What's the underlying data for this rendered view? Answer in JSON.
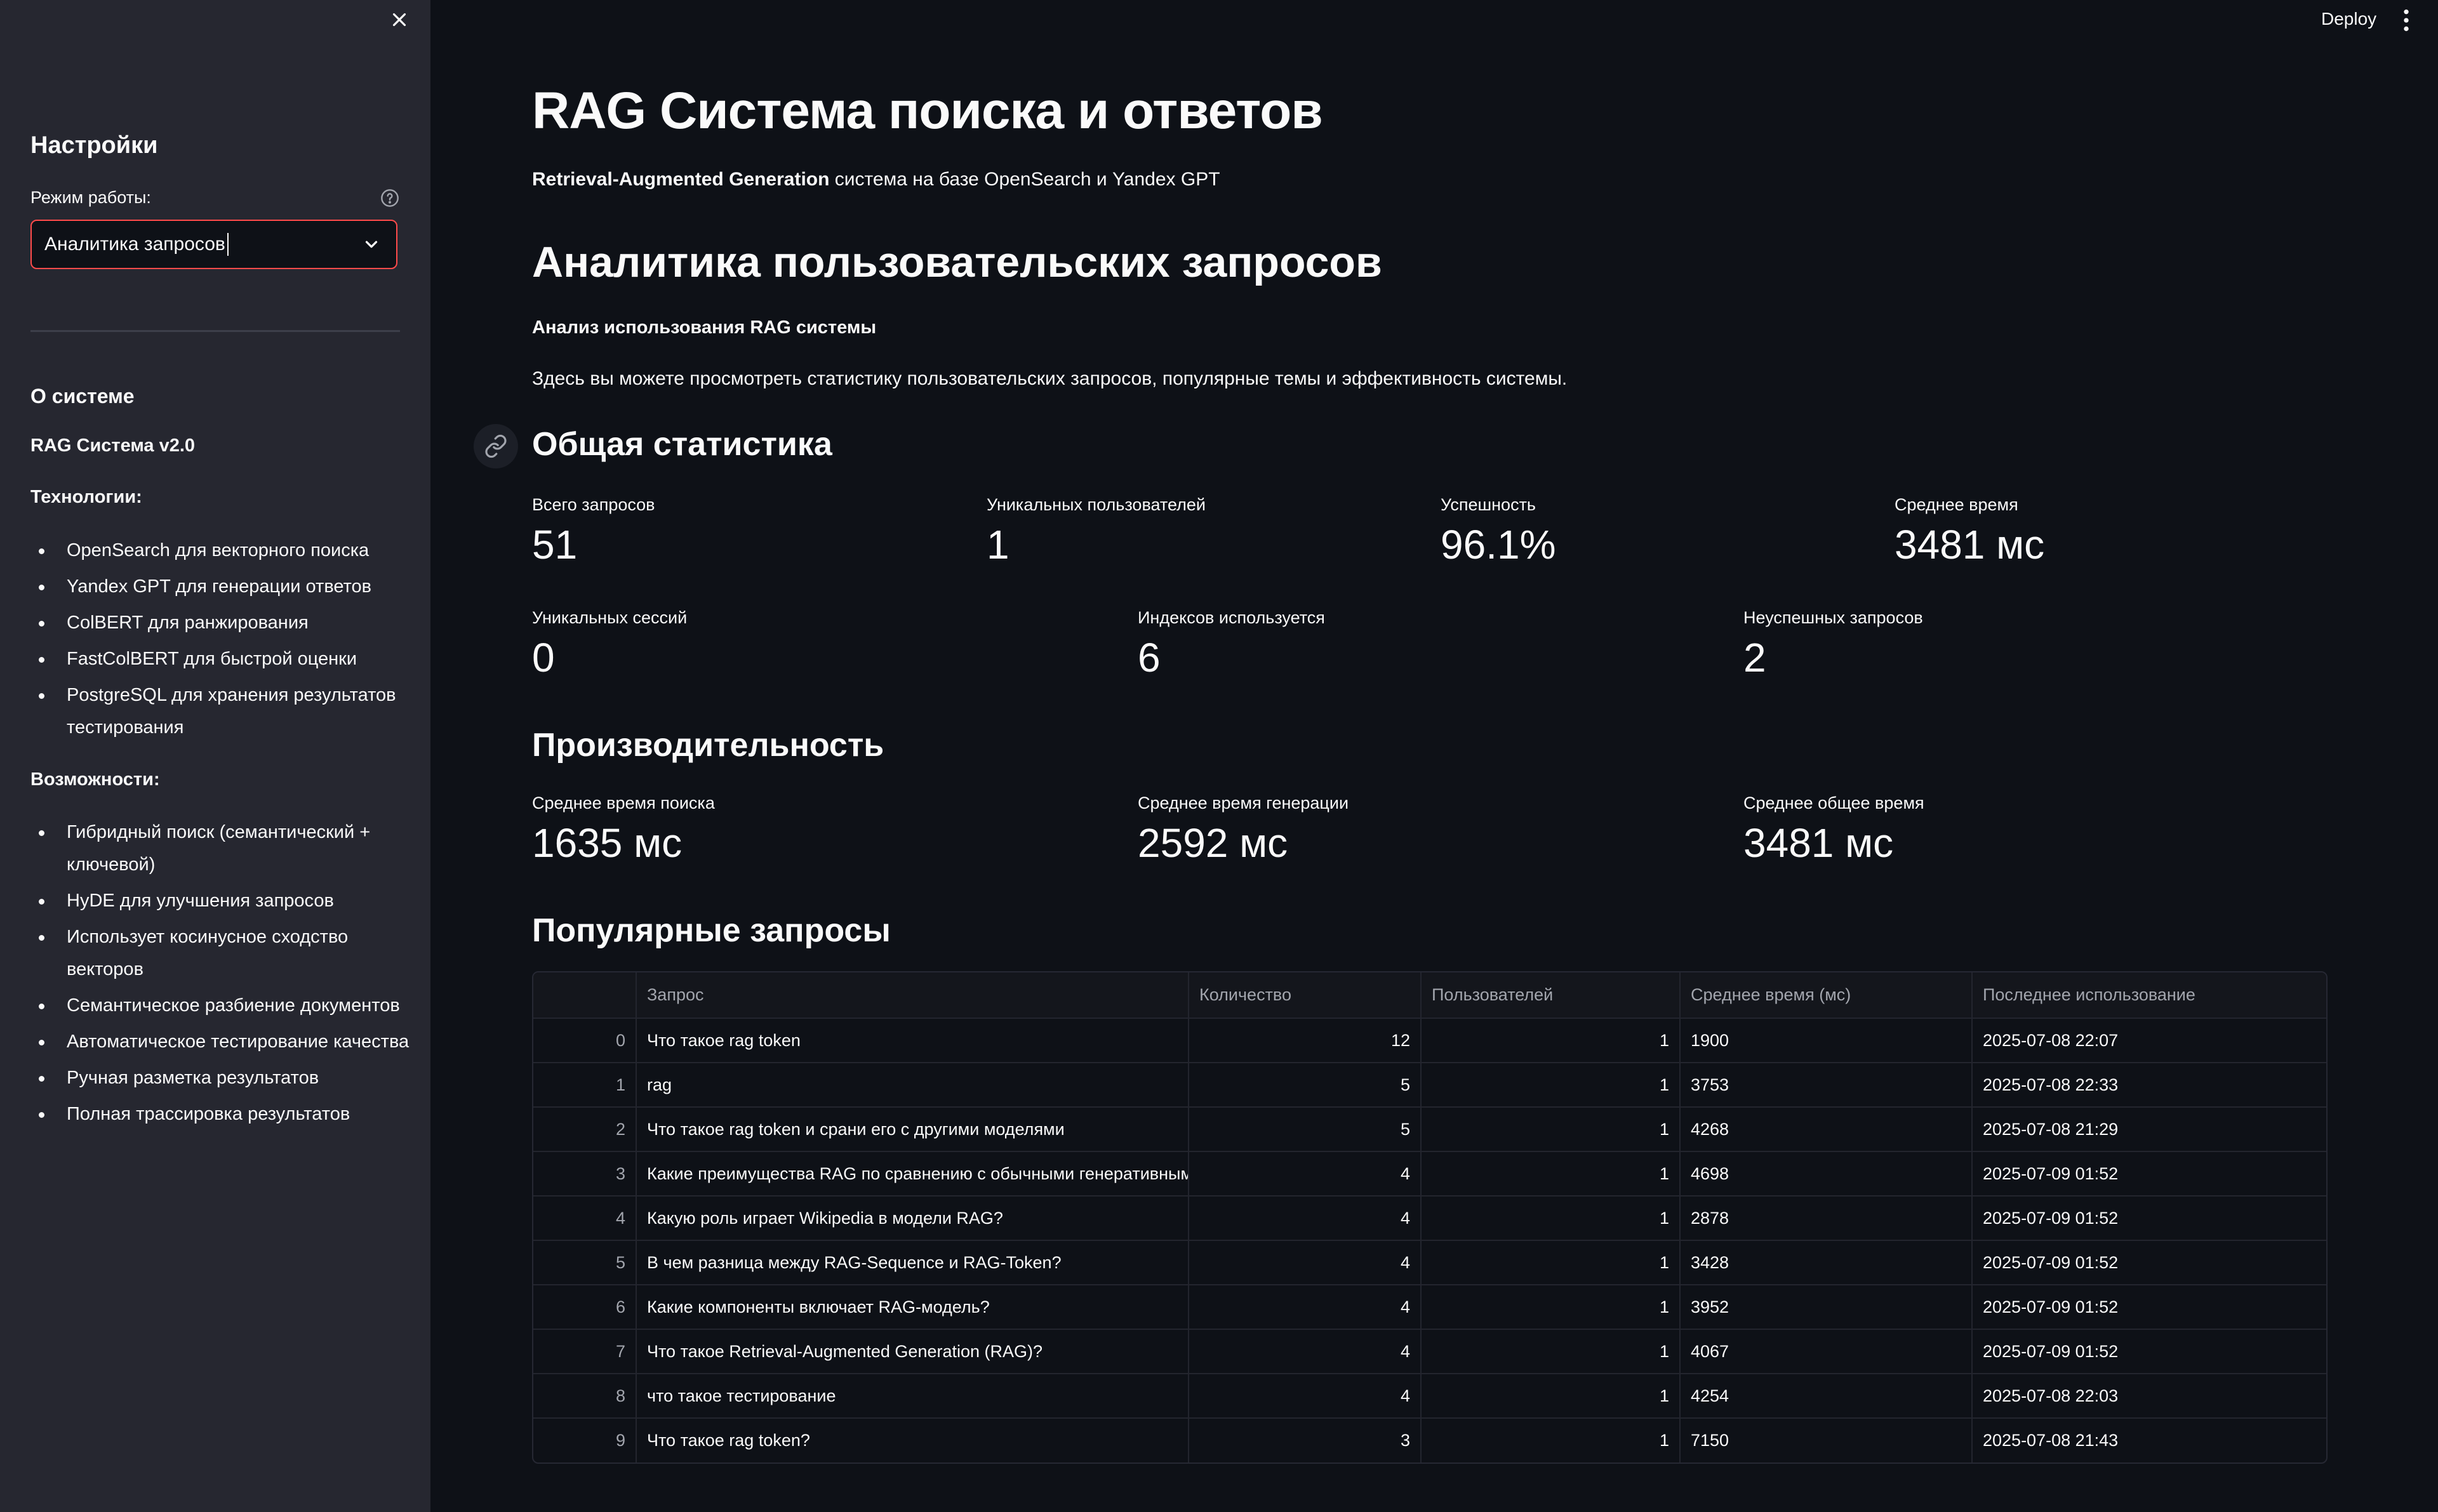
{
  "sidebar": {
    "title": "Настройки",
    "mode_label": "Режим работы:",
    "mode_value": "Аналитика запросов",
    "about_title": "О системе",
    "version": "RAG Система v2.0",
    "tech_title": "Технологии:",
    "tech_items": [
      "OpenSearch для векторного поиска",
      "Yandex GPT для генерации ответов",
      "ColBERT для ранжирования",
      "FastColBERT для быстрой оценки",
      "PostgreSQL для хранения результатов тестирования"
    ],
    "features_title": "Возможности:",
    "features": [
      "Гибридный поиск (семантический + ключевой)",
      "HyDE для улучшения запросов",
      "Использует косинусное сходство векторов",
      "Семантическое разбиение документов",
      "Автоматическое тестирование качества",
      "Ручная разметка результатов",
      "Полная трассировка результатов"
    ]
  },
  "header": {
    "deploy_label": "Deploy"
  },
  "main": {
    "title": "RAG Система поиска и ответов",
    "subtitle_bold": "Retrieval-Augmented Generation",
    "subtitle_rest": " система на базе OpenSearch и Yandex GPT",
    "analytics_title": "Аналитика пользовательских запросов",
    "analysis_subtitle": "Анализ использования RAG системы",
    "description": "Здесь вы можете просмотреть статистику пользовательских запросов, популярные темы и эффективность системы.",
    "general_stats_title": "Общая статистика",
    "metrics_row1": [
      {
        "label": "Всего запросов",
        "value": "51"
      },
      {
        "label": "Уникальных пользователей",
        "value": "1"
      },
      {
        "label": "Успешность",
        "value": "96.1%"
      },
      {
        "label": "Среднее время",
        "value": "3481 мс"
      }
    ],
    "metrics_row2": [
      {
        "label": "Уникальных сессий",
        "value": "0"
      },
      {
        "label": "Индексов используется",
        "value": "6"
      },
      {
        "label": "Неуспешных запросов",
        "value": "2"
      }
    ],
    "performance_title": "Производительность",
    "performance": [
      {
        "label": "Среднее время поиска",
        "value": "1635 мс"
      },
      {
        "label": "Среднее время генерации",
        "value": "2592 мс"
      },
      {
        "label": "Среднее общее время",
        "value": "3481 мс"
      }
    ],
    "popular_title": "Популярные запросы",
    "table": {
      "headers": [
        "",
        "Запрос",
        "Количество",
        "Пользователей",
        "Среднее время (мс)",
        "Последнее использование"
      ],
      "rows": [
        [
          "0",
          "Что такое rag token",
          "12",
          "1",
          "1900",
          "2025-07-08 22:07"
        ],
        [
          "1",
          "rag",
          "5",
          "1",
          "3753",
          "2025-07-08 22:33"
        ],
        [
          "2",
          "Что такое rag token и срани его с другими моделями",
          "5",
          "1",
          "4268",
          "2025-07-08 21:29"
        ],
        [
          "3",
          "Какие преимущества RAG по сравнению с обычными генеративными",
          "4",
          "1",
          "4698",
          "2025-07-09 01:52"
        ],
        [
          "4",
          "Какую роль играет Wikipedia в модели RAG?",
          "4",
          "1",
          "2878",
          "2025-07-09 01:52"
        ],
        [
          "5",
          "В чем разница между RAG-Sequence и RAG-Token?",
          "4",
          "1",
          "3428",
          "2025-07-09 01:52"
        ],
        [
          "6",
          "Какие компоненты включает RAG-модель?",
          "4",
          "1",
          "3952",
          "2025-07-09 01:52"
        ],
        [
          "7",
          "Что такое Retrieval-Augmented Generation (RAG)?",
          "4",
          "1",
          "4067",
          "2025-07-09 01:52"
        ],
        [
          "8",
          "что такое тестирование",
          "4",
          "1",
          "4254",
          "2025-07-08 22:03"
        ],
        [
          "9",
          "Что такое rag token?",
          "3",
          "1",
          "7150",
          "2025-07-08 21:43"
        ]
      ]
    }
  }
}
